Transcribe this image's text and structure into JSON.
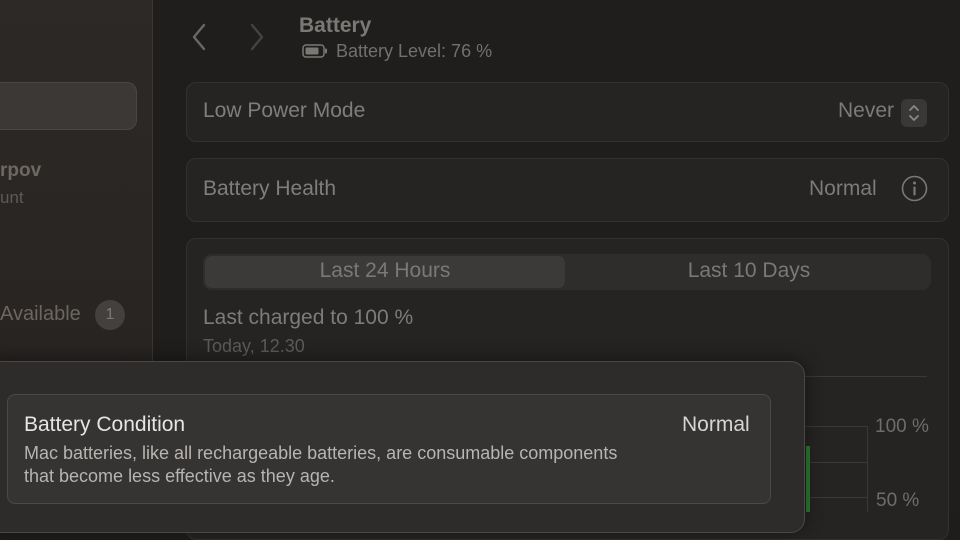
{
  "sidebar": {
    "user_name_fragment": "rpov",
    "user_sub_fragment": "unt",
    "updates_label_fragment": "Available",
    "updates_badge": "1"
  },
  "header": {
    "title": "Battery",
    "battery_level": "Battery Level: 76 %"
  },
  "low_power_mode": {
    "label": "Low Power Mode",
    "value": "Never"
  },
  "battery_health": {
    "label": "Battery Health",
    "value": "Normal"
  },
  "usage": {
    "tabs": [
      {
        "label": "Last 24 Hours"
      },
      {
        "label": "Last 10 Days"
      }
    ],
    "selected_tab": "Last 24 Hours",
    "last_charged": "Last charged to 100 %",
    "last_charged_time": "Today, 12.30",
    "ticks": [
      "100 %",
      "50 %"
    ]
  },
  "popover": {
    "title": "Battery Condition",
    "value": "Normal",
    "description": "Mac batteries, like all rechargeable batteries, are consumable components that become less effective as they age."
  },
  "colors": {
    "chart_bar": "#2a7a32"
  }
}
